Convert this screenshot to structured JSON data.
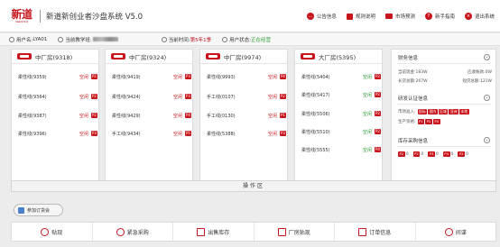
{
  "header": {
    "logo_main": "新道",
    "logo_sub": "SEENTAO",
    "title": "新道新创业者沙盘系统 V5.0",
    "nav": [
      {
        "label": "公告信息",
        "icon": "chat-icon"
      },
      {
        "label": "规则说明",
        "icon": "document-icon"
      },
      {
        "label": "市场预测",
        "icon": "mail-icon"
      },
      {
        "label": "新手指南",
        "icon": "help-icon"
      },
      {
        "label": "退出系统",
        "icon": "logout-icon"
      }
    ]
  },
  "status": {
    "user_label": "用户名:",
    "user_value": "LYA01",
    "teacher_label": "当前教学班:",
    "time_label": "当前时间:",
    "time_value": "第5年1季",
    "state_label": "用户状态:",
    "state_value": "正在经营"
  },
  "factories": [
    {
      "name": "中厂房(9318)",
      "lines": [
        {
          "name": "柔性线(9359)",
          "state": "空闲",
          "badge": "P2"
        },
        {
          "name": "柔性线(9364)",
          "state": "空闲",
          "badge": "P2"
        },
        {
          "name": "柔性线(9387)",
          "state": "空闲",
          "badge": "P2"
        },
        {
          "name": "柔性线(9396)",
          "state": "空闲",
          "badge": "P3"
        }
      ]
    },
    {
      "name": "中厂房(9324)",
      "lines": [
        {
          "name": "柔性线(9419)",
          "state": "空闲",
          "badge": "P3"
        },
        {
          "name": "柔性线(9424)",
          "state": "空闲",
          "badge": "P3"
        },
        {
          "name": "柔性线(9429)",
          "state": "空闲",
          "badge": "P4"
        },
        {
          "name": "手工线(9434)",
          "state": "空闲",
          "badge": "P5"
        }
      ]
    },
    {
      "name": "中厂房(9974)",
      "lines": [
        {
          "name": "柔性线(9993)",
          "state": "空闲",
          "badge": "P4"
        },
        {
          "name": "手工线(0107)",
          "state": "空闲",
          "badge": "P2"
        },
        {
          "name": "手工线(0130)",
          "state": "空闲",
          "badge": "P1"
        },
        {
          "name": "柔性线(5388)",
          "state": "空闲",
          "badge": "P3"
        }
      ]
    },
    {
      "name": "大厂房(5395)",
      "lines": [
        {
          "name": "柔性线(5404)",
          "state": "空闲",
          "badge": "P2"
        },
        {
          "name": "柔性线(5417)",
          "state": "空闲",
          "badge": "P2"
        },
        {
          "name": "柔性线(5506)",
          "state": "空闲",
          "badge": "P2"
        },
        {
          "name": "柔性线(5510)",
          "state": "空闲",
          "badge": "P2"
        },
        {
          "name": "柔性线(5555)",
          "state": "空闲",
          "badge": "P4"
        }
      ]
    }
  ],
  "finance": {
    "title": "财务信息",
    "rows": [
      {
        "left": "当前现金:183W",
        "right": "应收账款:0W"
      },
      {
        "left": "长贷总额:267W",
        "right": "短贷总额:121W"
      }
    ]
  },
  "rd": {
    "title": "研发认证信息",
    "market_label": "市场准入:",
    "markets": [
      "国际",
      "国内",
      "区域",
      "亚洲",
      "本地"
    ],
    "product_label": "生产资格:",
    "products": [
      "P1",
      "P2",
      "P4"
    ]
  },
  "inventory": {
    "title": "库存采购信息",
    "items": [
      {
        "code": "P2",
        "value": "0"
      },
      {
        "code": "P2",
        "value": "0"
      },
      {
        "code": "P3",
        "value": "0"
      },
      {
        "code": "P4",
        "value": "0"
      },
      {
        "code": "P2",
        "value": "0"
      }
    ]
  },
  "operation_area": "操作区",
  "order_button": "参加订货会",
  "actions": [
    {
      "label": "贴现",
      "icon": "discount-icon"
    },
    {
      "label": "紧急采购",
      "icon": "urgent-purchase-icon"
    },
    {
      "label": "出售库存",
      "icon": "sell-stock-icon"
    },
    {
      "label": "厂房贴现",
      "icon": "factory-discount-icon"
    },
    {
      "label": "订单信息",
      "icon": "order-info-icon"
    },
    {
      "label": "间谍",
      "icon": "spy-icon"
    }
  ]
}
